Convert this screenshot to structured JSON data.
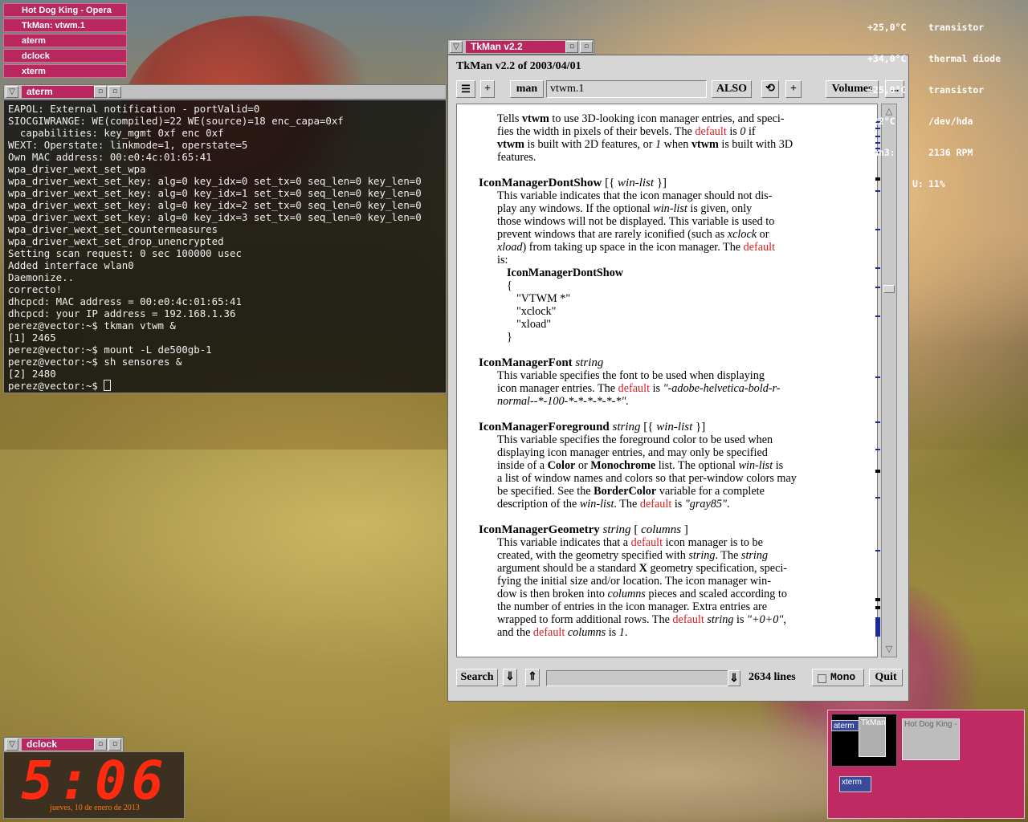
{
  "iconmanager": {
    "items": [
      {
        "label": "Hot Dog King - Opera"
      },
      {
        "label": "TkMan: vtwm.1"
      },
      {
        "label": "aterm"
      },
      {
        "label": "dclock"
      },
      {
        "label": "xterm"
      }
    ]
  },
  "aterm": {
    "title": "aterm",
    "lines": [
      "EAPOL: External notification - portValid=0",
      "SIOCGIWRANGE: WE(compiled)=22 WE(source)=18 enc_capa=0xf",
      "  capabilities: key_mgmt 0xf enc 0xf",
      "WEXT: Operstate: linkmode=1, operstate=5",
      "Own MAC address: 00:e0:4c:01:65:41",
      "wpa_driver_wext_set_wpa",
      "wpa_driver_wext_set_key: alg=0 key_idx=0 set_tx=0 seq_len=0 key_len=0",
      "wpa_driver_wext_set_key: alg=0 key_idx=1 set_tx=0 seq_len=0 key_len=0",
      "wpa_driver_wext_set_key: alg=0 key_idx=2 set_tx=0 seq_len=0 key_len=0",
      "wpa_driver_wext_set_key: alg=0 key_idx=3 set_tx=0 seq_len=0 key_len=0",
      "wpa_driver_wext_set_countermeasures",
      "wpa_driver_wext_set_drop_unencrypted",
      "Setting scan request: 0 sec 100000 usec",
      "Added interface wlan0",
      "Daemonize..",
      "correcto!",
      "dhcpcd: MAC address = 00:e0:4c:01:65:41",
      "dhcpcd: your IP address = 192.168.1.36",
      "perez@vector:~$ tkman vtwm &",
      "[1] 2465",
      "perez@vector:~$ mount -L de500gb-1",
      "perez@vector:~$ sh sensores &",
      "[2] 2480"
    ],
    "prompt": "perez@vector:~$ "
  },
  "tkman": {
    "title": "TkMan v2.2",
    "header": "TkMan v2.2 of 2003/04/01",
    "toolbar": {
      "plus1": "+",
      "man": "man",
      "entry_value": "vtwm.1",
      "also": "ALSO",
      "plus2": "+",
      "volumes": "Volumes",
      "more": "..."
    },
    "bottom": {
      "search": "Search",
      "down": "⇓",
      "up": "⇑",
      "lines": "2634 lines",
      "mono": "Mono",
      "quit": "Quit"
    },
    "doc": {
      "p1_a": "Tells ",
      "p1_b": "vtwm",
      "p1_c": " to use 3D-looking icon manager entries, and speci-",
      "p1_d": "fies the width in pixels of their bevels. The ",
      "p1_e": "default",
      "p1_f": " is ",
      "p1_g": "0",
      "p1_h": " if",
      "p1_i": "vtwm",
      "p1_j": " is built with 2D features, or ",
      "p1_k": "1",
      "p1_l": " when ",
      "p1_m": "vtwm",
      "p1_n": " is built with 3D",
      "p1_o": "features.",
      "h2": "IconManagerDontShow",
      "h2_a": " [{ ",
      "h2_b": "win-list",
      "h2_c": " }]",
      "p2_1": "This variable indicates that the icon manager should not dis-",
      "p2_2a": "play any windows. If the optional ",
      "p2_2b": "win-list",
      "p2_2c": " is given, only",
      "p2_3": "those windows will not be displayed. This variable is used to",
      "p2_4a": "prevent windows that are rarely iconified (such as ",
      "p2_4b": "xclock",
      "p2_4c": " or",
      "p2_5a": "xload",
      "p2_5b": ") from taking up space in the icon manager. The ",
      "p2_5c": "default",
      "p2_6": "is:",
      "c1": "IconManagerDontShow",
      "c2": "{",
      "c3": "\"VTWM *\"",
      "c4": "\"xclock\"",
      "c5": "\"xload\"",
      "c6": "}",
      "h3": "IconManagerFont",
      "h3_a": " string",
      "p3_1": "This variable specifies the font to be used when displaying",
      "p3_2a": "icon manager entries. The ",
      "p3_2b": "default",
      "p3_2c": " is ",
      "p3_2d": "\"-adobe-helvetica-bold-r-",
      "p3_3": "normal--*-100-*-*-*-*-*-*\".",
      "h4": "IconManagerForeground",
      "h4_a": " string",
      "h4_b": " [{ ",
      "h4_c": "win-list",
      "h4_d": " }]",
      "p4_1": "This variable specifies the foreground color to be used when",
      "p4_2": "displaying icon manager entries, and may only be specified",
      "p4_3a": "inside of a ",
      "p4_3b": "Color",
      "p4_3c": " or ",
      "p4_3d": "Monochrome",
      "p4_3e": " list. The optional ",
      "p4_3f": "win-list",
      "p4_3g": " is",
      "p4_4": "a list of window names and colors so that per-window colors may",
      "p4_5a": "be specified. See the ",
      "p4_5b": "BorderColor",
      "p4_5c": " variable for a complete",
      "p4_6a": "description of the ",
      "p4_6b": "win-list",
      "p4_6c": ". The ",
      "p4_6d": "default",
      "p4_6e": " is ",
      "p4_6f": "\"gray85\"",
      "p4_6g": ".",
      "h5": "IconManagerGeometry",
      "h5_a": " string",
      "h5_b": " [ ",
      "h5_c": "columns",
      "h5_d": " ]",
      "p5_1a": "This variable indicates that a ",
      "p5_1b": "default",
      "p5_1c": " icon manager is to be",
      "p5_2a": "created, with the geometry specified with ",
      "p5_2b": "string",
      "p5_2c": ". The ",
      "p5_2d": "string",
      "p5_3a": "argument should be a standard ",
      "p5_3b": "X",
      "p5_3c": " geometry specification, speci-",
      "p5_4": "fying the initial size and/or location. The icon manager win-",
      "p5_5a": "dow is then broken into ",
      "p5_5b": "columns",
      "p5_5c": " pieces and scaled according to",
      "p5_6": "the number of entries in the icon manager. Extra entries are",
      "p5_7a": "wrapped to form additional rows. The ",
      "p5_7b": "default",
      "p5_7c": " ",
      "p5_7d": "string",
      "p5_7e": " is ",
      "p5_7f": "\"+0+0\"",
      "p5_7g": ",",
      "p5_8a": "and the ",
      "p5_8b": "default",
      "p5_8c": " ",
      "p5_8d": "columns",
      "p5_8e": " is ",
      "p5_8f": "1",
      "p5_8g": "."
    }
  },
  "sensors": [
    {
      "value": "+25,0°C",
      "label": "transistor"
    },
    {
      "value": "+34,0°C",
      "label": "thermal diode"
    },
    {
      "value": "+25,0°C",
      "label": "transistor"
    },
    {
      "value": "+22°C",
      "label": "/dev/hda"
    },
    {
      "value": "fan3:",
      "label": "2136 RPM"
    },
    {
      "value": "U:",
      "label": "11%"
    }
  ],
  "dclock": {
    "title": "dclock",
    "time": "5:06",
    "date": "jueves, 10 de enero de 2013"
  },
  "pager": {
    "windows": [
      {
        "label": "aterm"
      },
      {
        "label": "TkMan:"
      },
      {
        "label": "Hot Dog King -"
      },
      {
        "label": "xterm"
      }
    ]
  },
  "colors": {
    "accent": "#b8285e",
    "link_red": "#d42020",
    "clock_red": "#ff2a10"
  }
}
